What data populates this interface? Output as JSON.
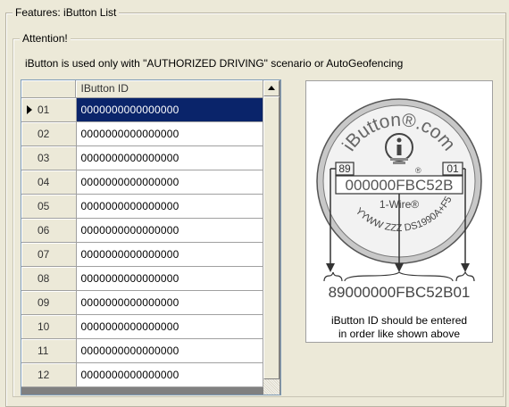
{
  "features_title": "Features: iButton List",
  "attention_title": "Attention!",
  "note": "iButton is used only with \"AUTHORIZED DRIVING\" scenario or AutoGeofencing",
  "grid": {
    "column_header": "IButton ID",
    "selected_index": 0,
    "rows": [
      {
        "num": "01",
        "id": "0000000000000000"
      },
      {
        "num": "02",
        "id": "0000000000000000"
      },
      {
        "num": "03",
        "id": "0000000000000000"
      },
      {
        "num": "04",
        "id": "0000000000000000"
      },
      {
        "num": "05",
        "id": "0000000000000000"
      },
      {
        "num": "06",
        "id": "0000000000000000"
      },
      {
        "num": "07",
        "id": "0000000000000000"
      },
      {
        "num": "08",
        "id": "0000000000000000"
      },
      {
        "num": "09",
        "id": "0000000000000000"
      },
      {
        "num": "10",
        "id": "0000000000000000"
      },
      {
        "num": "11",
        "id": "0000000000000000"
      },
      {
        "num": "12",
        "id": "0000000000000000"
      }
    ]
  },
  "ibutton_image": {
    "brand_text": "iButton®.com",
    "family_code": "89",
    "crc_code": "01",
    "serial": "000000FBC52B",
    "one_wire": "1-Wire®",
    "date_text": "YYWW ZZZ DS1990A+F5",
    "full_id": "89000000FBC52B01"
  },
  "caption_line1": "iButton ID should be entered",
  "caption_line2": "in order like shown above"
}
